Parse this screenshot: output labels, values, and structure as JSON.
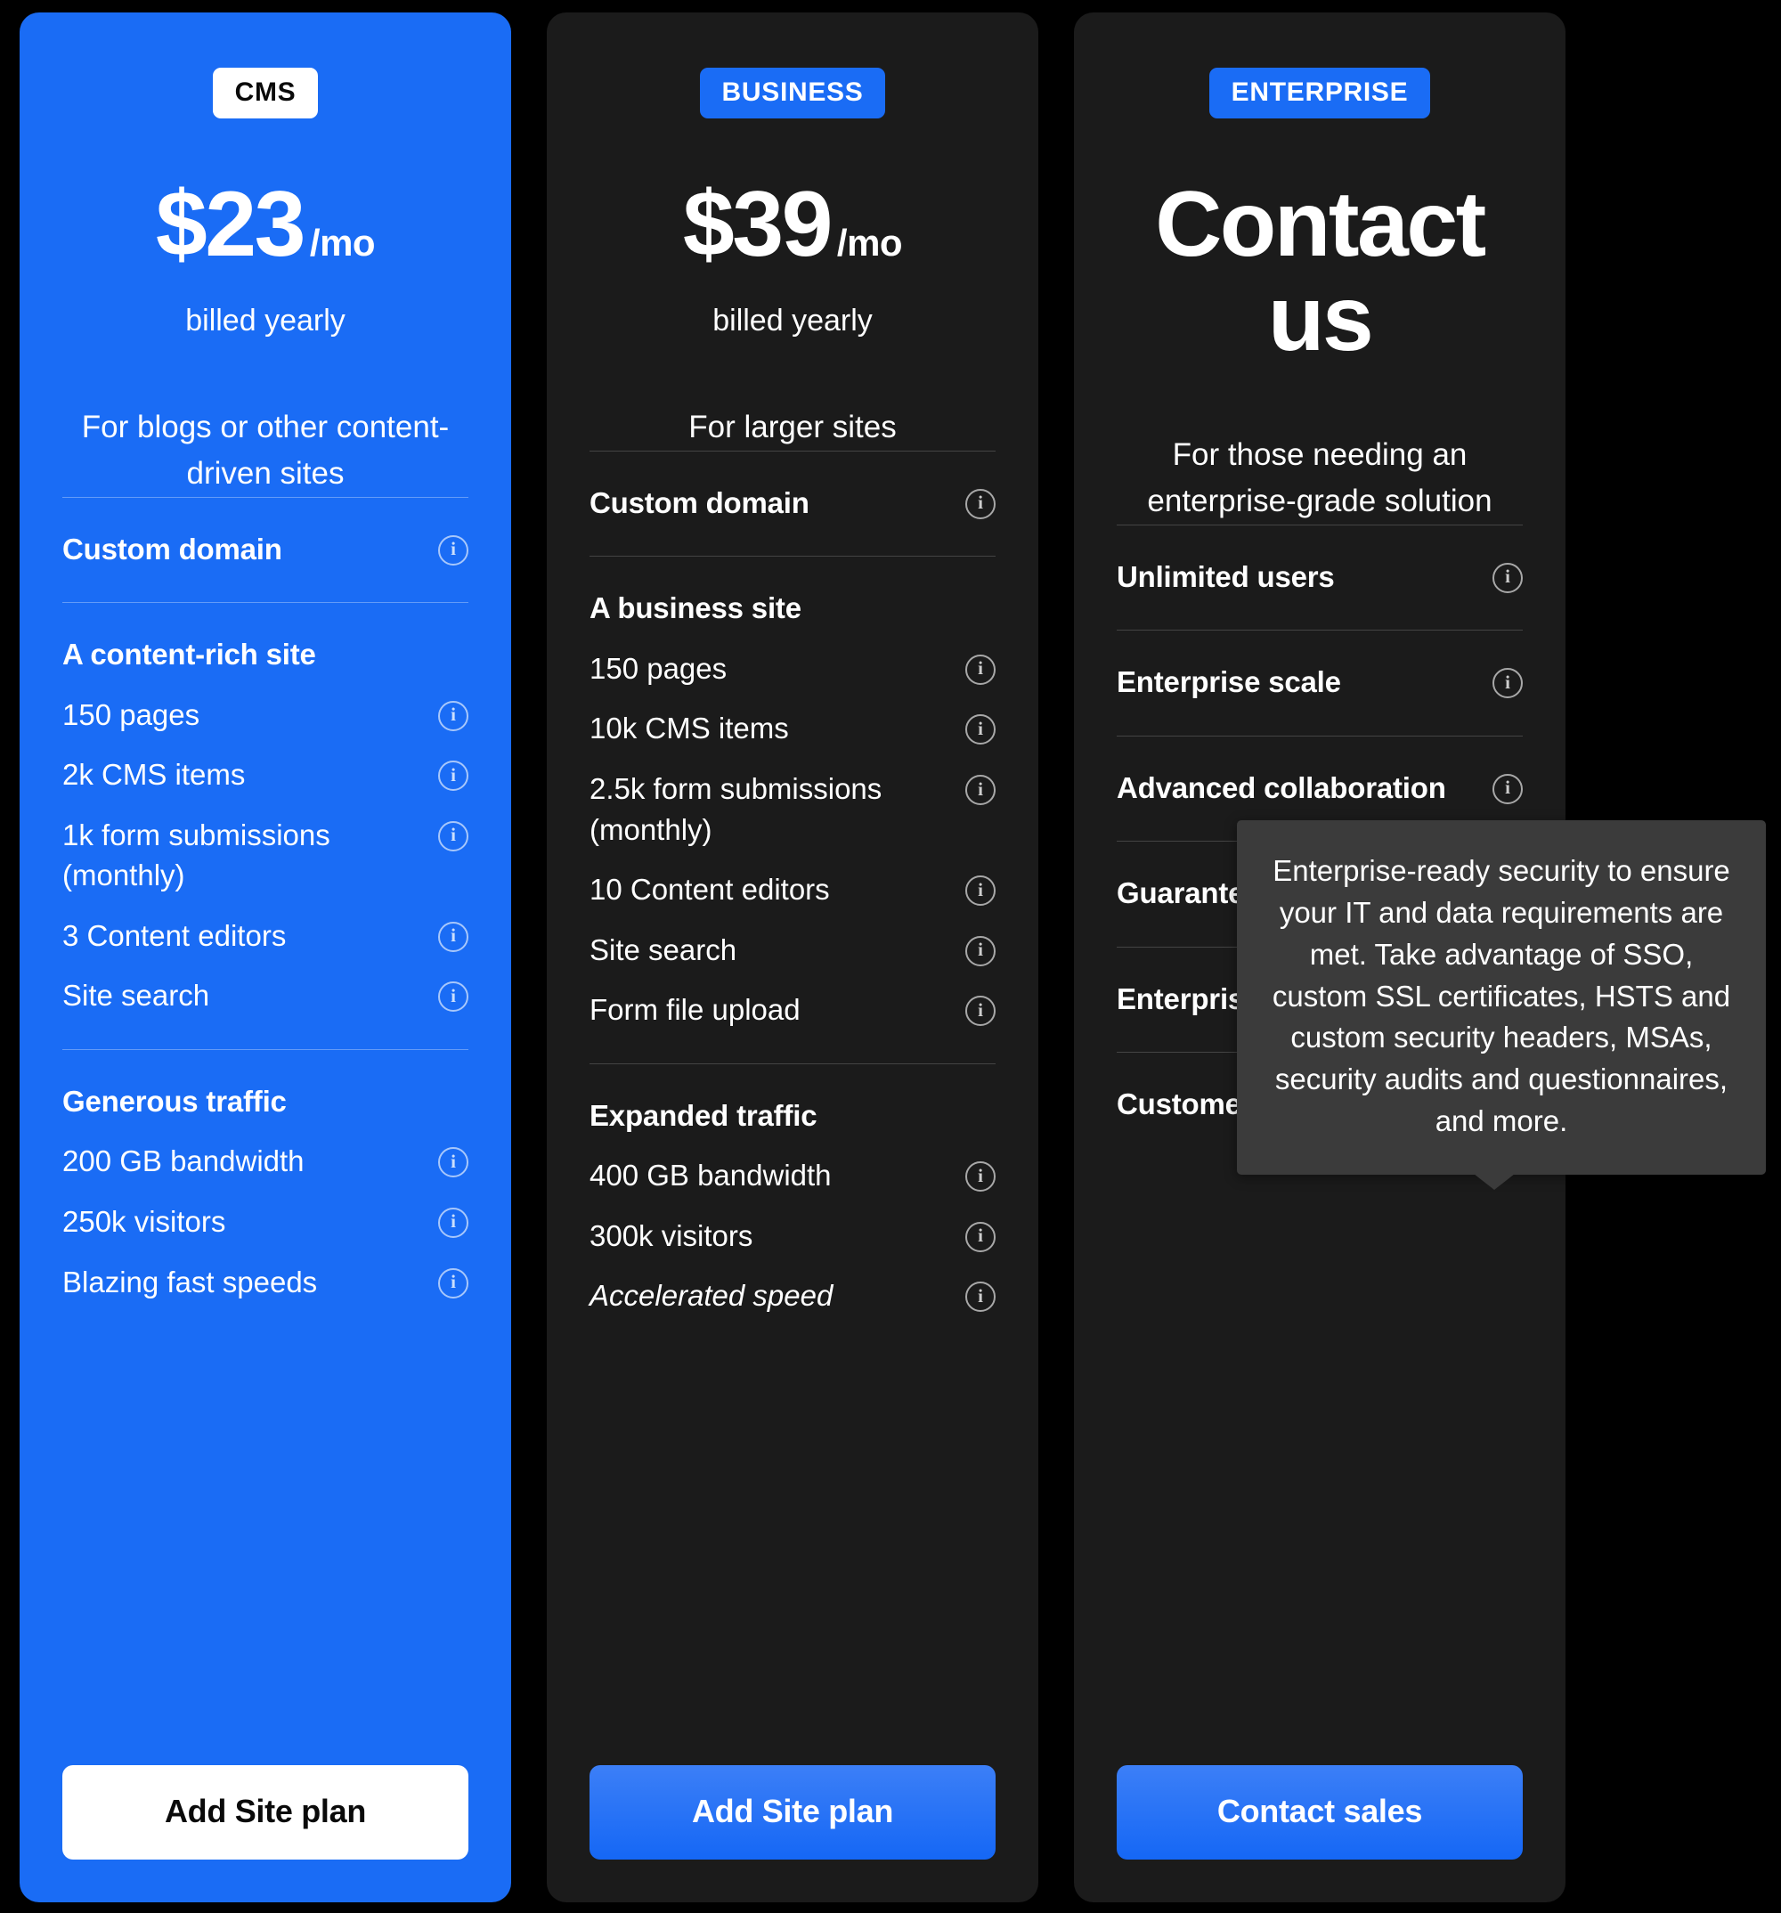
{
  "plans": [
    {
      "badge": "CMS",
      "price_amount": "$23",
      "price_period": "/mo",
      "billing": "billed yearly",
      "description": "For blogs or other content-driven sites",
      "groups": [
        {
          "items": [
            {
              "label": "Custom domain",
              "bold": true,
              "italic": false,
              "info": true
            }
          ]
        },
        {
          "items": [
            {
              "label": "A content-rich site",
              "bold": true,
              "italic": false,
              "info": false
            },
            {
              "label": "150 pages",
              "bold": false,
              "italic": false,
              "info": true
            },
            {
              "label": "2k CMS items",
              "bold": false,
              "italic": false,
              "info": true
            },
            {
              "label": "1k form submissions (monthly)",
              "bold": false,
              "italic": false,
              "info": true
            },
            {
              "label": "3 Content editors",
              "bold": false,
              "italic": false,
              "info": true
            },
            {
              "label": "Site search",
              "bold": false,
              "italic": false,
              "info": true
            }
          ]
        },
        {
          "items": [
            {
              "label": "Generous traffic",
              "bold": true,
              "italic": false,
              "info": false
            },
            {
              "label": "200 GB bandwidth",
              "bold": false,
              "italic": false,
              "info": true
            },
            {
              "label": "250k visitors",
              "bold": false,
              "italic": false,
              "info": true
            },
            {
              "label": "Blazing fast speeds",
              "bold": false,
              "italic": false,
              "info": true
            }
          ]
        }
      ],
      "cta_label": "Add Site plan"
    },
    {
      "badge": "BUSINESS",
      "price_amount": "$39",
      "price_period": "/mo",
      "billing": "billed yearly",
      "description": "For larger sites",
      "groups": [
        {
          "items": [
            {
              "label": "Custom domain",
              "bold": true,
              "italic": false,
              "info": true
            }
          ]
        },
        {
          "items": [
            {
              "label": "A business site",
              "bold": true,
              "italic": false,
              "info": false
            },
            {
              "label": "150 pages",
              "bold": false,
              "italic": false,
              "info": true
            },
            {
              "label": "10k CMS items",
              "bold": false,
              "italic": false,
              "info": true
            },
            {
              "label": "2.5k form submissions (monthly)",
              "bold": false,
              "italic": false,
              "info": true
            },
            {
              "label": "10 Content editors",
              "bold": false,
              "italic": false,
              "info": true
            },
            {
              "label": "Site search",
              "bold": false,
              "italic": false,
              "info": true
            },
            {
              "label": "Form file upload",
              "bold": false,
              "italic": false,
              "info": true
            }
          ]
        },
        {
          "items": [
            {
              "label": "Expanded traffic",
              "bold": true,
              "italic": false,
              "info": false
            },
            {
              "label": "400 GB bandwidth",
              "bold": false,
              "italic": false,
              "info": true
            },
            {
              "label": "300k visitors",
              "bold": false,
              "italic": false,
              "info": true
            },
            {
              "label": "Accelerated speed",
              "bold": false,
              "italic": true,
              "info": true
            }
          ]
        }
      ],
      "cta_label": "Add Site plan"
    },
    {
      "badge": "ENTERPRISE",
      "price_contact": "Contact us",
      "description": "For those needing  an enterprise-grade solution",
      "groups": [
        {
          "items": [
            {
              "label": "Unlimited users",
              "bold": true,
              "italic": false,
              "info": true
            }
          ]
        },
        {
          "items": [
            {
              "label": "Enterprise scale",
              "bold": true,
              "italic": false,
              "info": true
            }
          ]
        },
        {
          "items": [
            {
              "label": "Advanced collaboration",
              "bold": true,
              "italic": false,
              "info": true
            }
          ]
        },
        {
          "items": [
            {
              "label": "Guarantees",
              "bold": true,
              "italic": false,
              "info": true
            }
          ]
        },
        {
          "items": [
            {
              "label": "Enterprise security",
              "bold": true,
              "italic": false,
              "info": true,
              "active": true
            }
          ]
        },
        {
          "items": [
            {
              "label": "Customer success",
              "bold": true,
              "italic": false,
              "info": true
            }
          ]
        }
      ],
      "cta_label": "Contact sales"
    }
  ],
  "tooltip": {
    "text": "Enterprise-ready security to ensure your IT and data requirements are met. Take advantage of SSO, custom SSL certificates, HSTS and custom security headers, MSAs, security audits and questionnaires, and more."
  },
  "icons": {
    "info_glyph": "i"
  },
  "colors": {
    "accent_blue": "#1A6CF5",
    "card_dark": "#1B1B1B",
    "page_background": "#000000",
    "tooltip_background": "#3B3B3B",
    "text_light": "#FFFFFF"
  }
}
